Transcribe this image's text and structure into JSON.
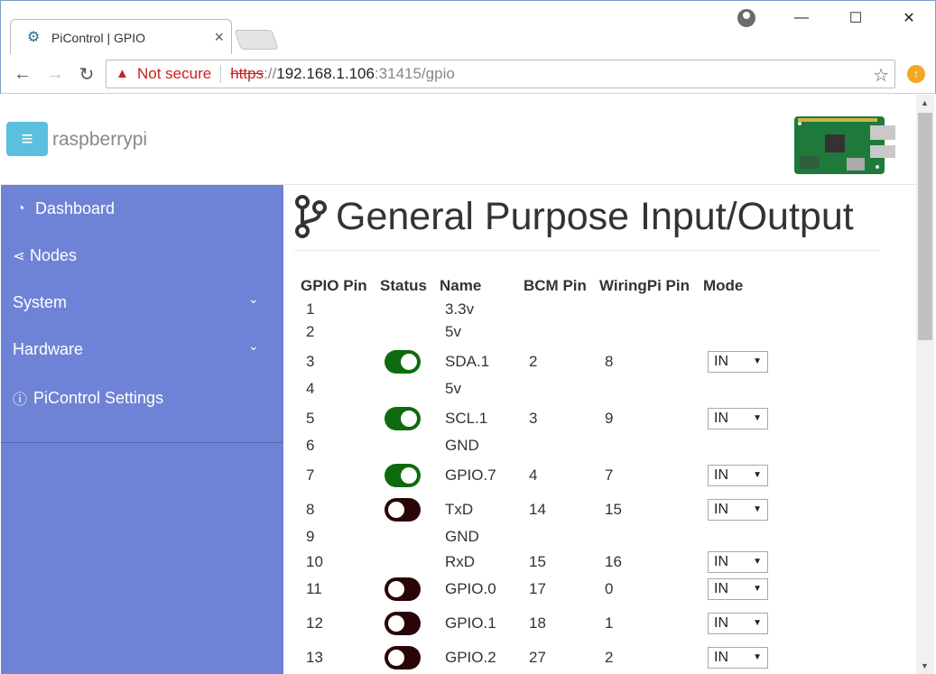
{
  "browser": {
    "tab_title": "PiControl | GPIO",
    "tab_close": "×",
    "address": {
      "security_label": "Not secure",
      "scheme": "https",
      "scheme_sep": "://",
      "host": "192.168.1.106",
      "rest": ":31415/gpio"
    },
    "icons": [
      "settings-cogs-icon",
      "close-icon",
      "profile-icon",
      "minimize-icon",
      "maximize-icon",
      "close-window-icon",
      "back-arrow-icon",
      "forward-arrow-icon",
      "reload-icon",
      "warning-icon",
      "star-icon",
      "update-icon"
    ]
  },
  "header": {
    "brand": "raspberrypi",
    "menu_icon": "≡"
  },
  "sidebar": {
    "items": [
      {
        "label": "Dashboard",
        "icon": "dashboard-icon",
        "expandable": false
      },
      {
        "label": "Nodes",
        "icon": "share-icon",
        "expandable": false
      },
      {
        "label": "System",
        "icon": "",
        "expandable": true
      },
      {
        "label": "Hardware",
        "icon": "",
        "expandable": true
      },
      {
        "label": "PiControl Settings",
        "icon": "info-icon",
        "expandable": false
      }
    ]
  },
  "main": {
    "title": "General Purpose Input/Output",
    "title_icon": "code-branch-icon",
    "columns": [
      "GPIO Pin",
      "Status",
      "Name",
      "BCM Pin",
      "WiringPi Pin",
      "Mode"
    ],
    "rows": [
      {
        "pin": "1",
        "status": "",
        "name": "3.3v",
        "bcm": "",
        "wiringpi": "",
        "mode": ""
      },
      {
        "pin": "2",
        "status": "",
        "name": "5v",
        "bcm": "",
        "wiringpi": "",
        "mode": ""
      },
      {
        "pin": "3",
        "status": "on",
        "name": "SDA.1",
        "bcm": "2",
        "wiringpi": "8",
        "mode": "IN"
      },
      {
        "pin": "4",
        "status": "",
        "name": "5v",
        "bcm": "",
        "wiringpi": "",
        "mode": ""
      },
      {
        "pin": "5",
        "status": "on",
        "name": "SCL.1",
        "bcm": "3",
        "wiringpi": "9",
        "mode": "IN"
      },
      {
        "pin": "6",
        "status": "",
        "name": "GND",
        "bcm": "",
        "wiringpi": "",
        "mode": ""
      },
      {
        "pin": "7",
        "status": "on",
        "name": "GPIO.7",
        "bcm": "4",
        "wiringpi": "7",
        "mode": "IN"
      },
      {
        "pin": "8",
        "status": "off",
        "name": "TxD",
        "bcm": "14",
        "wiringpi": "15",
        "mode": "IN"
      },
      {
        "pin": "9",
        "status": "",
        "name": "GND",
        "bcm": "",
        "wiringpi": "",
        "mode": ""
      },
      {
        "pin": "10",
        "status": "",
        "name": "RxD",
        "bcm": "15",
        "wiringpi": "16",
        "mode": "IN"
      },
      {
        "pin": "11",
        "status": "off",
        "name": "GPIO.0",
        "bcm": "17",
        "wiringpi": "0",
        "mode": "IN"
      },
      {
        "pin": "12",
        "status": "off",
        "name": "GPIO.1",
        "bcm": "18",
        "wiringpi": "1",
        "mode": "IN"
      },
      {
        "pin": "13",
        "status": "off",
        "name": "GPIO.2",
        "bcm": "27",
        "wiringpi": "2",
        "mode": "IN"
      }
    ]
  },
  "colors": {
    "sidebar_bg": "#6f83d6",
    "toggle_on": "#0e6a0e",
    "toggle_off": "#2a0505",
    "menu_button": "#5bc0de",
    "insecure_red": "#c5221f"
  }
}
